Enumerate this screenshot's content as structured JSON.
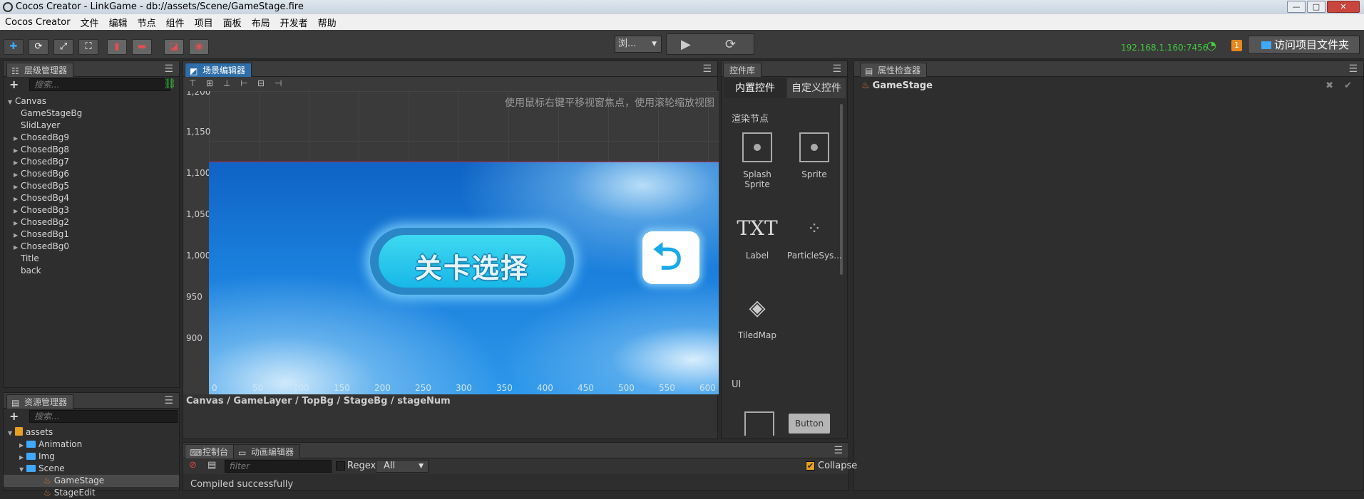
{
  "window": {
    "title": "Cocos Creator - LinkGame - db://assets/Scene/GameStage.fire",
    "controls": [
      "—",
      "□",
      "✕"
    ]
  },
  "menu": [
    "Cocos Creator",
    "文件",
    "编辑",
    "节点",
    "组件",
    "项目",
    "面板",
    "布局",
    "开发者",
    "帮助"
  ],
  "toolbar": {
    "preview_select": "浏...",
    "ip": "192.168.1.160:7456",
    "notification_count": "1",
    "visit_folder": "访问项目文件夹"
  },
  "hierarchy": {
    "tab": "层级管理器",
    "search_placeholder": "搜索...",
    "root": "Canvas",
    "children": [
      {
        "label": "GameStageBg",
        "expandable": false
      },
      {
        "label": "SlidLayer",
        "expandable": false
      },
      {
        "label": "ChosedBg9",
        "expandable": true
      },
      {
        "label": "ChosedBg8",
        "expandable": true
      },
      {
        "label": "ChosedBg7",
        "expandable": true
      },
      {
        "label": "ChosedBg6",
        "expandable": true
      },
      {
        "label": "ChosedBg5",
        "expandable": true
      },
      {
        "label": "ChosedBg4",
        "expandable": true
      },
      {
        "label": "ChosedBg3",
        "expandable": true
      },
      {
        "label": "ChosedBg2",
        "expandable": true
      },
      {
        "label": "ChosedBg1",
        "expandable": true
      },
      {
        "label": "ChosedBg0",
        "expandable": true
      },
      {
        "label": "Title",
        "expandable": false
      },
      {
        "label": "back",
        "expandable": false
      }
    ]
  },
  "assets": {
    "tab": "资源管理器",
    "search_placeholder": "搜索...",
    "items": [
      "assets",
      "Animation",
      "Img",
      "Scene",
      "GameStage",
      "StageEdit"
    ]
  },
  "scene": {
    "tab": "场景编辑器",
    "hint": "使用鼠标右键平移视窗焦点，使用滚轮缩放视图",
    "y_labels": [
      "1,200",
      "1,150",
      "1,100",
      "1,050",
      "1,000",
      "950",
      "900"
    ],
    "x_labels": [
      "0",
      "50",
      "100",
      "150",
      "200",
      "250",
      "300",
      "350",
      "400",
      "450",
      "500",
      "550",
      "600"
    ],
    "level_button_text": "关卡选择",
    "breadcrumb": "Canvas / GameLayer / TopBg / StageBg / stageNum"
  },
  "library": {
    "tab": "控件库",
    "tabs": [
      "内置控件",
      "自定义控件"
    ],
    "section_render": "渲染节点",
    "section_ui": "UI",
    "widgets": [
      "Splash Sprite",
      "Sprite",
      "Label",
      "ParticleSys...",
      "TiledMap"
    ],
    "txt_glyph": "TXT",
    "button_widget": "Button"
  },
  "inspector": {
    "tab": "属性检查器",
    "node_name": "GameStage"
  },
  "console": {
    "tabs": [
      "控制台",
      "动画编辑器"
    ],
    "filter_placeholder": "filter",
    "regex_label": "Regex",
    "level_select": "All",
    "collapse_label": "Collapse",
    "message": "Compiled successfully"
  }
}
